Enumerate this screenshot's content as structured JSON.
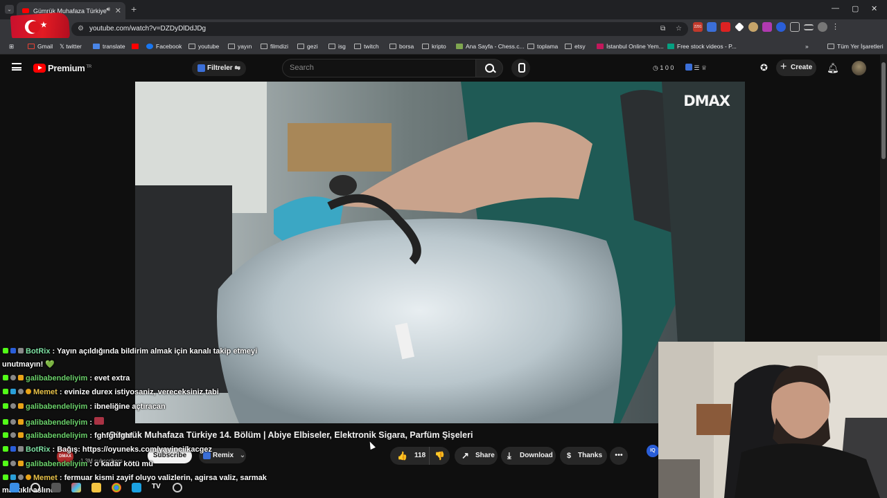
{
  "browser": {
    "tab_title": "Gümrük Muhafaza Türkiye",
    "url": "youtube.com/watch?v=DZDyDlDdJDg",
    "bookmarks": [
      "Gmail",
      "twitter",
      "translate",
      "",
      "Facebook",
      "youtube",
      "yayın",
      "filmdizi",
      "gezi",
      "isg",
      "twitch",
      "borsa",
      "kripto",
      "Ana Sayfa - Chess.c...",
      "toplama",
      "etsy",
      "İstanbul Online Yem...",
      "Free stock videos - P...",
      "Tüm Yer İşaretleri"
    ],
    "ext_badge": "2291"
  },
  "youtube": {
    "logo_text": "Premium",
    "logo_sup": "TR",
    "filters_label": "Filtreler",
    "search_placeholder": "Search",
    "counters": "1   0   0",
    "create_label": "Create"
  },
  "video": {
    "watermark": "DMAX",
    "title": "Gümrük Muhafaza Türkiye 14. Bölüm | Abiye Elbiseler, Elektronik Sigara, Parfüm Şişeleri",
    "channel_avatar_text": "DMAX",
    "subscribers": "1,3M subscribers",
    "subscribe_label": "Subscribe",
    "remix_label": "Remix",
    "likes": "118",
    "share_label": "Share",
    "download_label": "Download",
    "thanks_label": "Thanks",
    "more_label": "•••"
  },
  "chat": [
    {
      "user": "BotRix",
      "text": ": Yayın açıldığında bildirim almak için kanalı takip etmeyi"
    },
    {
      "user": "",
      "text": "unutmayın! 💚"
    },
    {
      "user": "galibabendeliyim",
      "text": ": evet extra"
    },
    {
      "user": "Memet",
      "text": ": evinize durex istiyosaniz, vereceksiniz tabi"
    },
    {
      "user": "galibabendeliyim",
      "text": ": ibneliğine açtıracan"
    },
    {
      "user": "galibabendeliyim",
      "text": ":"
    },
    {
      "user": "galibabendeliyim",
      "text": ": fghfghfghf"
    },
    {
      "user": "BotRix",
      "text": ": Bağış: https://oyuneks.com/yayinci/kacgez"
    },
    {
      "user": "galibabendeliyim",
      "text": ": o kadar kötü mü"
    },
    {
      "user": "Memet",
      "text": ": fermuar kismi zayif oluyo valizlerin, agirsa valiz, sarmak"
    },
    {
      "user": "",
      "text": "mantıklı aslında"
    }
  ]
}
